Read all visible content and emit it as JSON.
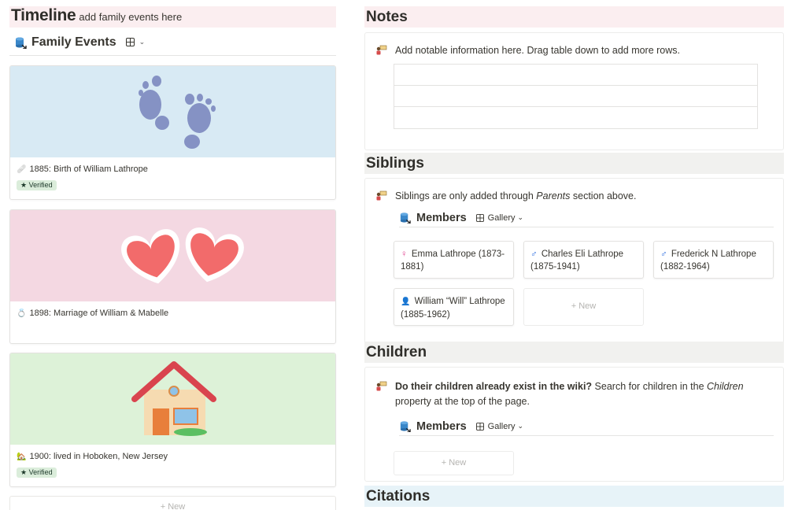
{
  "timeline": {
    "title": "Timeline",
    "subtitle": "add family events here",
    "database_title": "Family Events",
    "view_icon": "grid-icon",
    "events": [
      {
        "icon": "bandage-icon",
        "title": "1885: Birth of William Lathrope",
        "badge": "★ Verified",
        "cover": "baby-footprints",
        "cover_color": "#d8eaf4"
      },
      {
        "icon": "ring-icon",
        "title": "1898: Marriage of William & Mabelle",
        "badge": "",
        "cover": "two-hearts",
        "cover_color": "#f4d8e2"
      },
      {
        "icon": "house-icon",
        "title": "1900: lived in Hoboken, New Jersey",
        "badge": "★ Verified",
        "cover": "house",
        "cover_color": "#ddf2d8"
      }
    ],
    "new_label": "+ New"
  },
  "notes": {
    "title": "Notes",
    "text": "Add notable information here. Drag table down to add more rows."
  },
  "siblings": {
    "title": "Siblings",
    "text_prefix": "Siblings are only added through ",
    "text_em": "Parents",
    "text_suffix": " section above.",
    "members_title": "Members",
    "view_label": "Gallery",
    "members": [
      {
        "symbol": "♀",
        "color": "#e0418f",
        "name": "Emma Lathrope (1873-1881)"
      },
      {
        "symbol": "♂",
        "color": "#2f6fe0",
        "name": "Charles Eli Lathrope (1875-1941)"
      },
      {
        "symbol": "♂",
        "color": "#2f6fe0",
        "name": "Frederick N Lathrope (1882-1964)"
      },
      {
        "symbol": "👤",
        "color": "#2f6fe0",
        "name": "William “Will” Lathrope (1885-1962)"
      }
    ],
    "new_label": "+ New"
  },
  "children": {
    "title": "Children",
    "text_bold": "Do their children already exist in the wiki?",
    "text_mid": " Search for children in the ",
    "text_em": "Children",
    "text_suffix": " property at the top of the page.",
    "members_title": "Members",
    "view_label": "Gallery",
    "new_label": "+ New"
  },
  "citations": {
    "title": "Citations"
  },
  "colors": {
    "timeline_header_bg": "#fbeef0",
    "notes_header_bg": "#fbeef0",
    "siblings_header_bg": "#f1f1ef",
    "children_header_bg": "#f1f1ef",
    "citations_header_bg": "#e7f3f8",
    "verified_bg": "#dbeddb"
  }
}
